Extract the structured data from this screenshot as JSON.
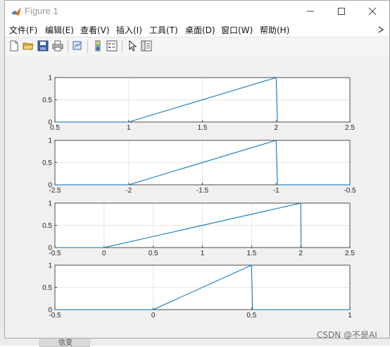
{
  "window": {
    "title": "Figure 1"
  },
  "menu": {
    "items": [
      "文件(F)",
      "编辑(E)",
      "查看(V)",
      "插入(I)",
      "工具(T)",
      "桌面(D)",
      "窗口(W)",
      "帮助(H)"
    ]
  },
  "toolbar": {
    "icons": [
      "new-figure-icon",
      "open-file-icon",
      "save-icon",
      "print-icon",
      "link-plot-icon",
      "insert-colorbar-icon",
      "insert-legend-icon",
      "edit-plot-arrow-icon",
      "property-inspector-icon"
    ]
  },
  "background": {
    "tab_label": "信变"
  },
  "watermark": "CSDN @不是AI",
  "colors": {
    "line": "#0072BD",
    "grid": "#e6e6e6",
    "axes_bg": "#ffffff"
  },
  "chart_data": [
    {
      "type": "line",
      "xlim": [
        0.5,
        2.5
      ],
      "ylim": [
        0,
        1
      ],
      "xticks": [
        "0.5",
        "1",
        "1.5",
        "2",
        "2.5"
      ],
      "yticks": [
        "0",
        "0.5",
        "1"
      ],
      "grid": true,
      "x": [
        0.5,
        1,
        2,
        2.01
      ],
      "y": [
        0,
        0,
        1,
        0
      ]
    },
    {
      "type": "line",
      "xlim": [
        -2.5,
        -0.5
      ],
      "ylim": [
        0,
        1
      ],
      "xticks": [
        "-2.5",
        "-2",
        "-1.5",
        "-1",
        "-0.5"
      ],
      "yticks": [
        "0",
        "0.5",
        "1"
      ],
      "grid": true,
      "x": [
        -2.5,
        -2,
        -1,
        -0.99,
        -0.5
      ],
      "y": [
        0,
        0,
        1,
        0,
        0
      ]
    },
    {
      "type": "line",
      "xlim": [
        -0.5,
        2.5
      ],
      "ylim": [
        0,
        1
      ],
      "xticks": [
        "-0.5",
        "0",
        "0.5",
        "1",
        "1.5",
        "2",
        "2.5"
      ],
      "yticks": [
        "0",
        "0.5",
        "1"
      ],
      "grid": true,
      "x": [
        -0.5,
        0,
        2,
        2.005
      ],
      "y": [
        0,
        0,
        1,
        0
      ]
    },
    {
      "type": "line",
      "xlim": [
        -0.5,
        1
      ],
      "ylim": [
        0,
        1
      ],
      "xticks": [
        "-0.5",
        "0",
        "0.5",
        "1"
      ],
      "yticks": [
        "0",
        "0.5",
        "1"
      ],
      "grid": true,
      "x": [
        -0.5,
        0,
        0.5,
        0.505,
        1
      ],
      "y": [
        0,
        0,
        1,
        0,
        0
      ]
    }
  ]
}
